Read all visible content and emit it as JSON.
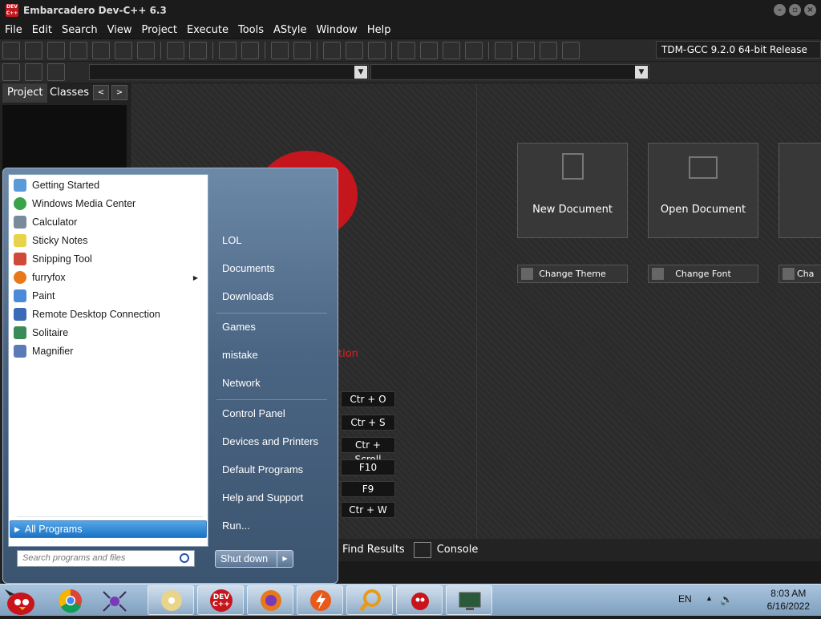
{
  "window": {
    "title": "Embarcadero Dev-C++ 6.3",
    "logo_text": "DEV C++"
  },
  "menu": [
    "File",
    "Edit",
    "Search",
    "View",
    "Project",
    "Execute",
    "Tools",
    "AStyle",
    "Window",
    "Help"
  ],
  "compiler": "TDM-GCC 9.2.0 64-bit Release",
  "panel_tabs": {
    "project": "Project",
    "classes": "Classes",
    "prev": "<",
    "next": ">"
  },
  "welcome": {
    "tiles": [
      {
        "label": "New Document"
      },
      {
        "label": "Open Document"
      }
    ],
    "settings": [
      {
        "label": "Change Theme"
      },
      {
        "label": "Change Font"
      },
      {
        "label": "Cha"
      }
    ],
    "red_text": "tion",
    "shortcuts": [
      "Ctr + O",
      "Ctr + S",
      "Ctr + Scroll",
      "F10",
      "F9",
      "Ctr + W"
    ]
  },
  "bottom_tabs": {
    "find_results": "Find Results",
    "console": "Console"
  },
  "start_menu": {
    "programs": [
      {
        "label": "Getting Started",
        "color": "#5a9ad8"
      },
      {
        "label": "Windows Media Center",
        "color": "#3aa34a"
      },
      {
        "label": "Calculator",
        "color": "#7a8a9a"
      },
      {
        "label": "Sticky Notes",
        "color": "#e8d44a"
      },
      {
        "label": "Snipping Tool",
        "color": "#d04a3a"
      },
      {
        "label": "furryfox",
        "color": "#e8781a"
      },
      {
        "label": "Paint",
        "color": "#4a8ad8"
      },
      {
        "label": "Remote Desktop Connection",
        "color": "#3a6ab8"
      },
      {
        "label": "Solitaire",
        "color": "#3a8a5a"
      },
      {
        "label": "Magnifier",
        "color": "#5a7ab8"
      }
    ],
    "all_programs": "All Programs",
    "search_placeholder": "Search programs and files",
    "places": [
      "LOL",
      "Documents",
      "Downloads",
      "Games",
      "mistake",
      "Network",
      "Control Panel",
      "Devices and Printers",
      "Default Programs",
      "Help and Support",
      "Run..."
    ],
    "shutdown": "Shut down"
  },
  "taskbar": {
    "lang": "EN",
    "time": "8:03 AM",
    "date": "6/16/2022",
    "dev_badge": "DEV C++"
  }
}
